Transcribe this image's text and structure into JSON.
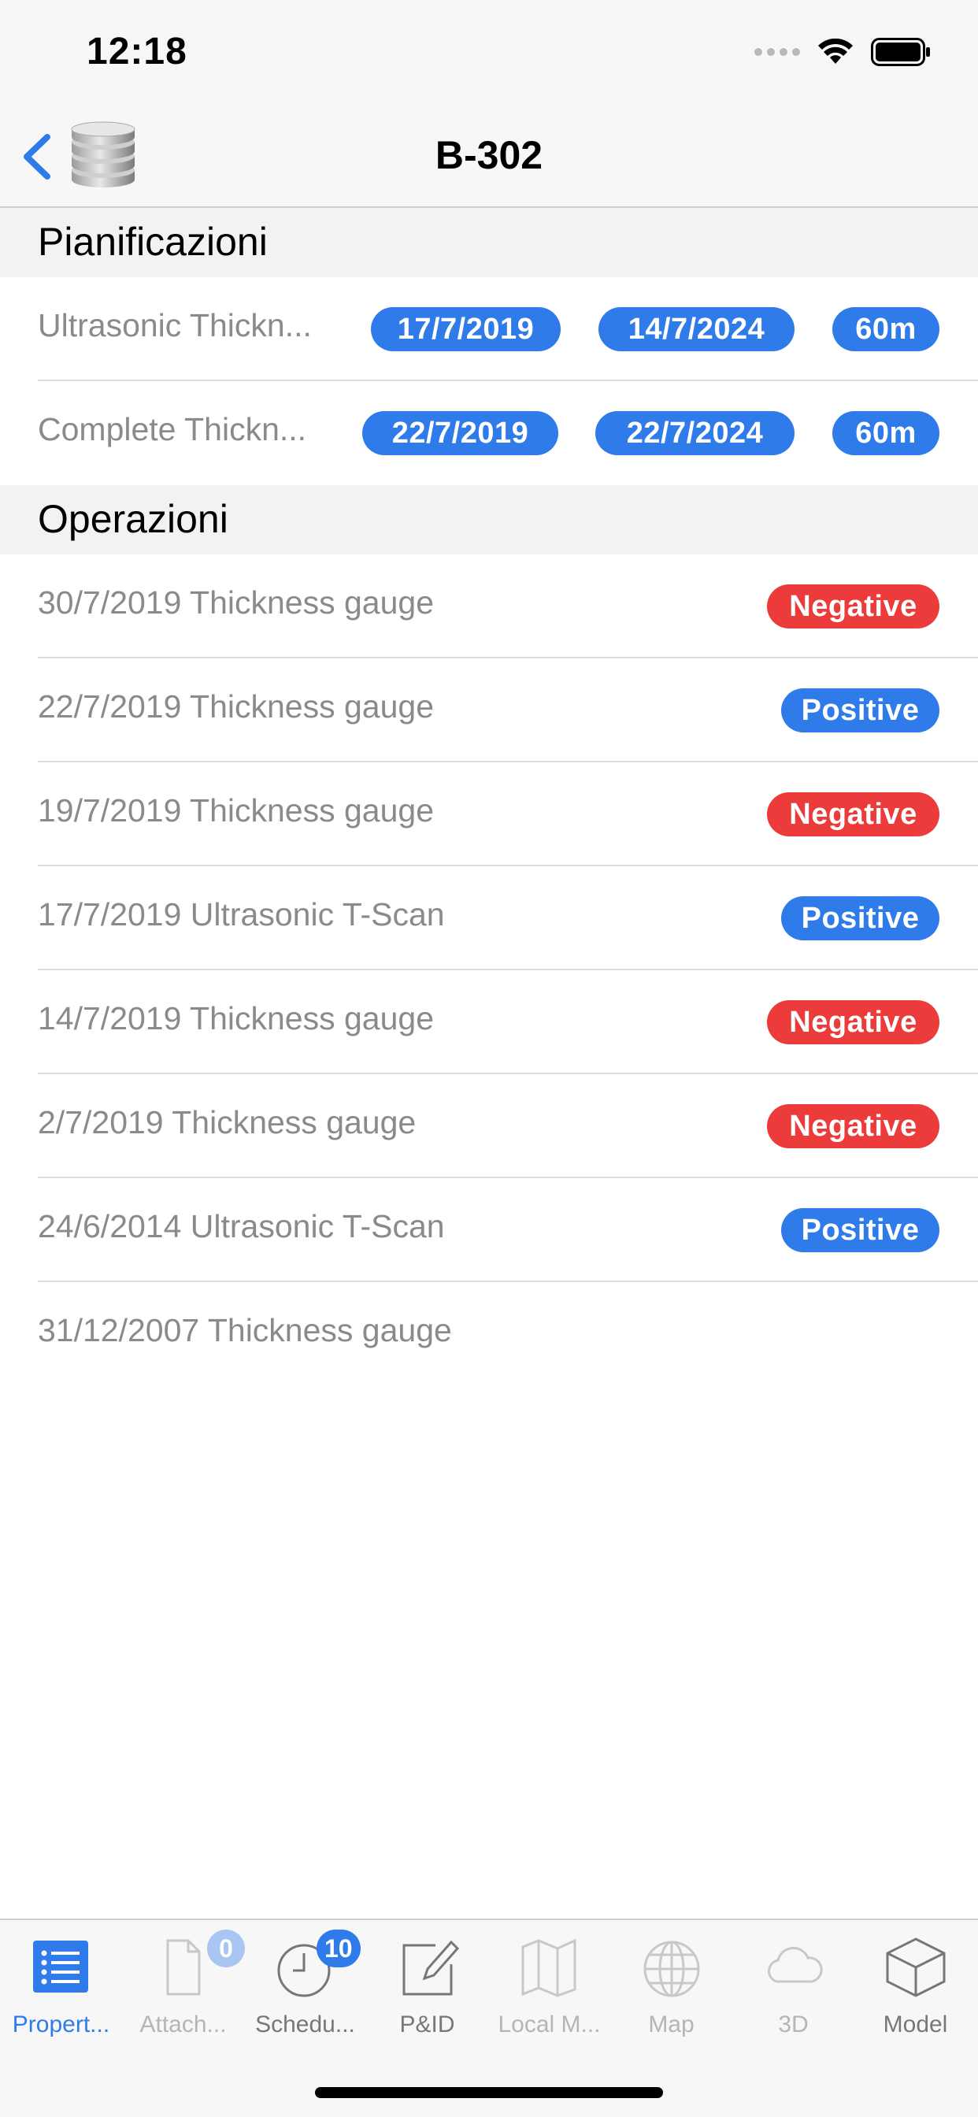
{
  "status_bar": {
    "time": "12:18"
  },
  "nav": {
    "title": "B-302"
  },
  "sections": {
    "planning": {
      "title": "Pianificazioni"
    },
    "operations": {
      "title": "Operazioni"
    }
  },
  "planning_rows": [
    {
      "name": "Ultrasonic Thickn...",
      "start": "17/7/2019",
      "end": "14/7/2024",
      "interval": "60m"
    },
    {
      "name": "Complete Thickn...",
      "start": "22/7/2019",
      "end": "22/7/2024",
      "interval": "60m"
    }
  ],
  "operation_rows": [
    {
      "text": "30/7/2019 Thickness gauge",
      "result": "Negative"
    },
    {
      "text": "22/7/2019 Thickness gauge",
      "result": "Positive"
    },
    {
      "text": "19/7/2019 Thickness gauge",
      "result": "Negative"
    },
    {
      "text": "17/7/2019 Ultrasonic T-Scan",
      "result": "Positive"
    },
    {
      "text": "14/7/2019 Thickness gauge",
      "result": "Negative"
    },
    {
      "text": "2/7/2019 Thickness gauge",
      "result": "Negative"
    },
    {
      "text": "24/6/2014 Ultrasonic T-Scan",
      "result": "Positive"
    },
    {
      "text": "31/12/2007 Thickness gauge",
      "result": ""
    }
  ],
  "tabs": [
    {
      "label": "Propert...",
      "icon": "list-icon",
      "state": "active"
    },
    {
      "label": "Attach...",
      "icon": "document-icon",
      "badge": "0",
      "state": "disabled"
    },
    {
      "label": "Schedu...",
      "icon": "clock-icon",
      "badge": "10",
      "state": "normal"
    },
    {
      "label": "P&ID",
      "icon": "edit-icon",
      "state": "normal"
    },
    {
      "label": "Local M...",
      "icon": "map-icon",
      "state": "disabled"
    },
    {
      "label": "Map",
      "icon": "globe-icon",
      "state": "disabled"
    },
    {
      "label": "3D",
      "icon": "cloud-icon",
      "state": "disabled"
    },
    {
      "label": "Model",
      "icon": "cube-icon",
      "state": "normal"
    }
  ],
  "colors": {
    "accent": "#2f7bea",
    "negative": "#ec3b3b",
    "positive": "#2f7bea"
  }
}
